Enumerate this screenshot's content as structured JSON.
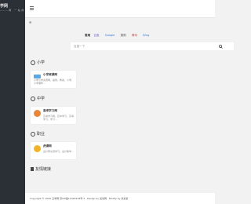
{
  "sidebar": {
    "logo_title": "学网",
    "logo_subtitle": "——— 网 · 一 站 搜"
  },
  "topbar": {
    "menu_icon": "hamburger-menu-icon"
  },
  "notice": "✉",
  "search": {
    "label": "常用",
    "engines": [
      "百度",
      "Google",
      "搜狗",
      "神马",
      "Bing"
    ],
    "placeholder": "百度一下",
    "button_icon": "search-icon"
  },
  "sections": [
    {
      "title": "小学",
      "card": {
        "title": "小学资源网",
        "desc": "小学小学资源网，提供，教案，小学，小学课件..."
      }
    },
    {
      "title": "中学",
      "card": {
        "title": "高考学力网",
        "desc": "高考学习网，高中学习，高考学习，学习..."
      }
    },
    {
      "title": "职业",
      "card": {
        "title": "虎课网",
        "desc": "设计师交流学习，设计教学..."
      }
    }
  ],
  "links_title": "友情链接",
  "footer": "Copyright © 2020 云学网 京ICP备12345678号-3 · Design by 某某网 · Modify by 某某某"
}
